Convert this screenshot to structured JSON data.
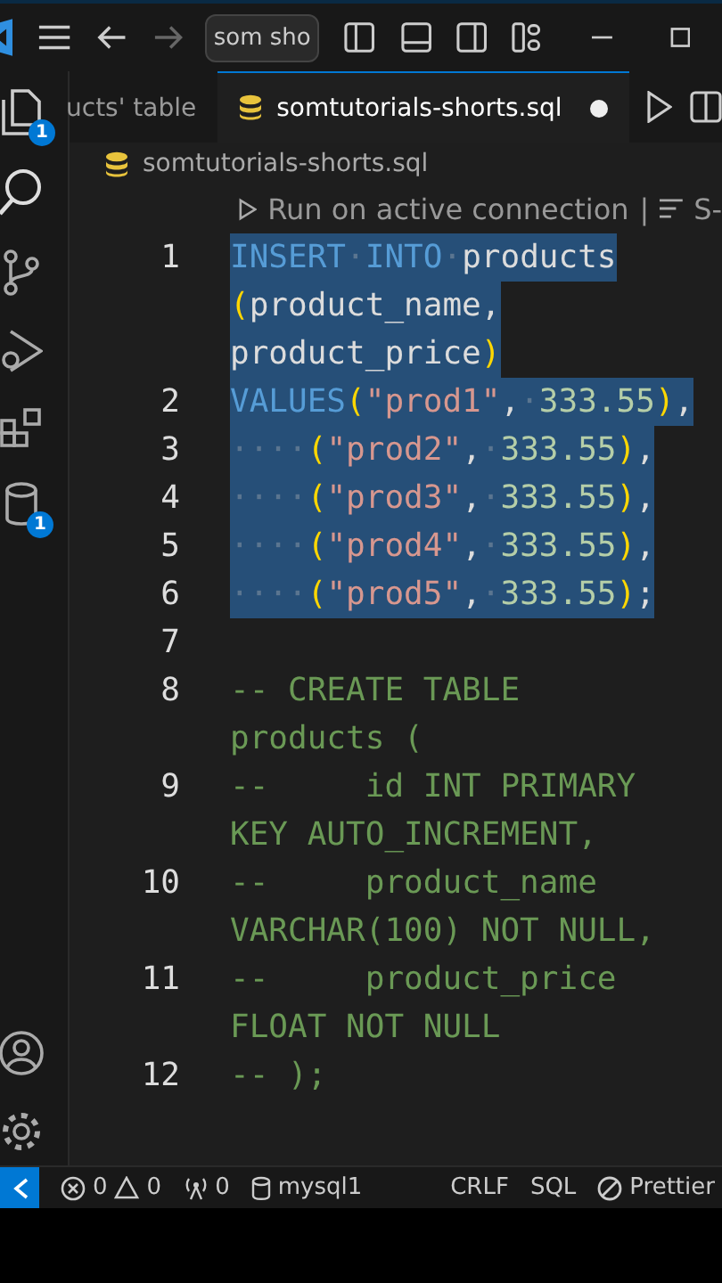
{
  "title_bar": {
    "search": "som sho"
  },
  "activity_bar": {
    "explorer_badge": "1",
    "database_badge": "1"
  },
  "tabs": [
    {
      "label": "ucts' table",
      "selected": false,
      "dirty": false
    },
    {
      "label": "somtutorials-shorts.sql",
      "selected": true,
      "dirty": true
    }
  ],
  "breadcrumb": "somtutorials-shorts.sql",
  "codelens": {
    "run": "Run on active connection",
    "separator": "|",
    "more": "S-"
  },
  "lines": [
    {
      "number": "1",
      "selected": true,
      "rows": [
        [
          {
            "kind": "keyword",
            "text": "INSERT"
          },
          {
            "kind": "space",
            "text": "·"
          },
          {
            "kind": "keyword",
            "text": "INTO"
          },
          {
            "kind": "space",
            "text": "·"
          },
          {
            "kind": "ident",
            "text": "products"
          }
        ],
        [
          {
            "kind": "paren",
            "text": "("
          },
          {
            "kind": "ident",
            "text": "product_name,"
          }
        ],
        [
          {
            "kind": "ident",
            "text": "product_price"
          },
          {
            "kind": "paren",
            "text": ")"
          }
        ]
      ]
    },
    {
      "number": "2",
      "selected": true,
      "rows": [
        [
          {
            "kind": "keyword",
            "text": "VALUES"
          },
          {
            "kind": "paren",
            "text": "("
          },
          {
            "kind": "string",
            "text": "\"prod1\""
          },
          {
            "kind": "ident",
            "text": ","
          },
          {
            "kind": "space",
            "text": "·"
          },
          {
            "kind": "number",
            "text": "333.55"
          },
          {
            "kind": "paren",
            "text": ")"
          },
          {
            "kind": "ident",
            "text": ","
          }
        ]
      ]
    },
    {
      "number": "3",
      "selected": true,
      "rows": [
        [
          {
            "kind": "space",
            "text": "····"
          },
          {
            "kind": "paren",
            "text": "("
          },
          {
            "kind": "string",
            "text": "\"prod2\""
          },
          {
            "kind": "ident",
            "text": ","
          },
          {
            "kind": "space",
            "text": "·"
          },
          {
            "kind": "number",
            "text": "333.55"
          },
          {
            "kind": "paren",
            "text": ")"
          },
          {
            "kind": "ident",
            "text": ","
          }
        ]
      ]
    },
    {
      "number": "4",
      "selected": true,
      "rows": [
        [
          {
            "kind": "space",
            "text": "····"
          },
          {
            "kind": "paren",
            "text": "("
          },
          {
            "kind": "string",
            "text": "\"prod3\""
          },
          {
            "kind": "ident",
            "text": ","
          },
          {
            "kind": "space",
            "text": "·"
          },
          {
            "kind": "number",
            "text": "333.55"
          },
          {
            "kind": "paren",
            "text": ")"
          },
          {
            "kind": "ident",
            "text": ","
          }
        ]
      ]
    },
    {
      "number": "5",
      "selected": true,
      "rows": [
        [
          {
            "kind": "space",
            "text": "····"
          },
          {
            "kind": "paren",
            "text": "("
          },
          {
            "kind": "string",
            "text": "\"prod4\""
          },
          {
            "kind": "ident",
            "text": ","
          },
          {
            "kind": "space",
            "text": "·"
          },
          {
            "kind": "number",
            "text": "333.55"
          },
          {
            "kind": "paren",
            "text": ")"
          },
          {
            "kind": "ident",
            "text": ","
          }
        ]
      ]
    },
    {
      "number": "6",
      "selected": true,
      "rows": [
        [
          {
            "kind": "space",
            "text": "····"
          },
          {
            "kind": "paren",
            "text": "("
          },
          {
            "kind": "string",
            "text": "\"prod5\""
          },
          {
            "kind": "ident",
            "text": ","
          },
          {
            "kind": "space",
            "text": "·"
          },
          {
            "kind": "number",
            "text": "333.55"
          },
          {
            "kind": "paren",
            "text": ")"
          },
          {
            "kind": "ident",
            "text": ";"
          }
        ]
      ]
    },
    {
      "number": "7",
      "selected": false,
      "rows": [
        []
      ]
    },
    {
      "number": "8",
      "selected": false,
      "rows": [
        [
          {
            "kind": "comment",
            "text": "-- CREATE TABLE"
          }
        ],
        [
          {
            "kind": "comment",
            "text": "products ("
          }
        ]
      ]
    },
    {
      "number": "9",
      "selected": false,
      "rows": [
        [
          {
            "kind": "comment",
            "text": "--     id INT PRIMARY"
          }
        ],
        [
          {
            "kind": "comment",
            "text": "KEY AUTO_INCREMENT,"
          }
        ]
      ]
    },
    {
      "number": "10",
      "selected": false,
      "rows": [
        [
          {
            "kind": "comment",
            "text": "--     product_name"
          }
        ],
        [
          {
            "kind": "comment",
            "text": "VARCHAR(100) NOT NULL,"
          }
        ]
      ]
    },
    {
      "number": "11",
      "selected": false,
      "rows": [
        [
          {
            "kind": "comment",
            "text": "--     product_price"
          }
        ],
        [
          {
            "kind": "comment",
            "text": "FLOAT NOT NULL"
          }
        ]
      ]
    },
    {
      "number": "12",
      "selected": false,
      "rows": [
        [
          {
            "kind": "comment",
            "text": "-- );"
          }
        ]
      ]
    }
  ],
  "status_bar": {
    "errors": "0",
    "warnings": "0",
    "ports": "0",
    "connection": "mysql1",
    "eol": "CRLF",
    "language": "SQL",
    "formatter": "Prettier"
  }
}
